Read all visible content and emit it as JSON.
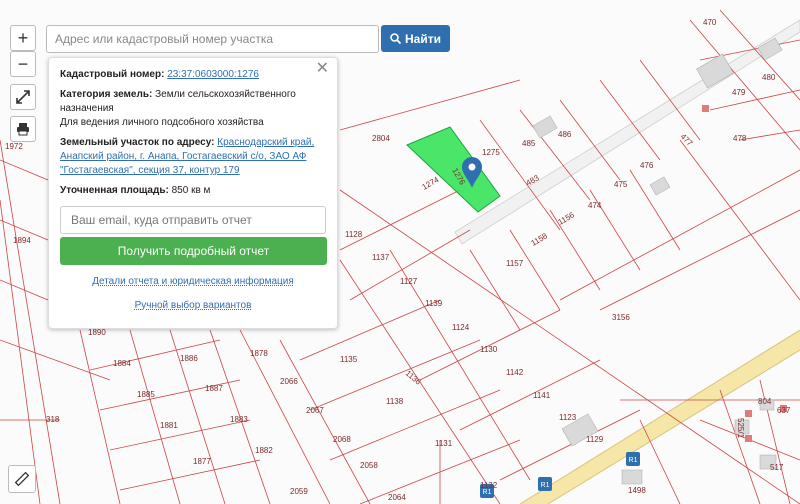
{
  "search": {
    "placeholder": "Адрес или кадастровый номер участка",
    "button_label": "Найти"
  },
  "controls": {
    "zoom_in": "+",
    "zoom_out": "−"
  },
  "panel": {
    "cad_label": "Кадастровый номер:",
    "cad_value": "23:37:0603000:1276",
    "cat_label": "Категория земель:",
    "cat_value": "Земли сельскохозяйственного назначения",
    "use_value": "Для ведения личного подсобного хозяйства",
    "addr_label": "Земельный участок по адресу:",
    "addr_value": "Краснодарский край, Анапский район, г. Анапа, Гостагаевский с/о, ЗАО АФ \"Гостагаевская\", секция 37, контур 179",
    "area_label": "Уточненная площадь:",
    "area_value": "850 кв м",
    "email_placeholder": "Ваш email, куда отправить отчет",
    "report_button": "Получить подробный отчет",
    "details_link": "Детали отчета и юридическая информация",
    "manual_link": "Ручной выбор вариантов"
  },
  "map": {
    "parcel_labels": [
      "2804",
      "1275",
      "485",
      "486",
      "483",
      "476",
      "477",
      "478",
      "479",
      "480",
      "470",
      "1274",
      "475",
      "474",
      "1156",
      "1158",
      "1157",
      "1128",
      "1137",
      "1127",
      "1139",
      "1124",
      "1130",
      "1142",
      "1141",
      "1123",
      "1129",
      "3156",
      "1136",
      "1138",
      "1135",
      "1131",
      "1132",
      "2068",
      "2058",
      "2064",
      "2059",
      "1878",
      "2066",
      "2067",
      "1886",
      "1887",
      "1885",
      "1883",
      "1881",
      "1882",
      "1877",
      "1884",
      "1890",
      "1894",
      "1972",
      "318",
      "1498",
      "804",
      "637",
      "525/1",
      "517",
      "1276"
    ],
    "road_signs": [
      "R1",
      "R1",
      "R1"
    ]
  }
}
